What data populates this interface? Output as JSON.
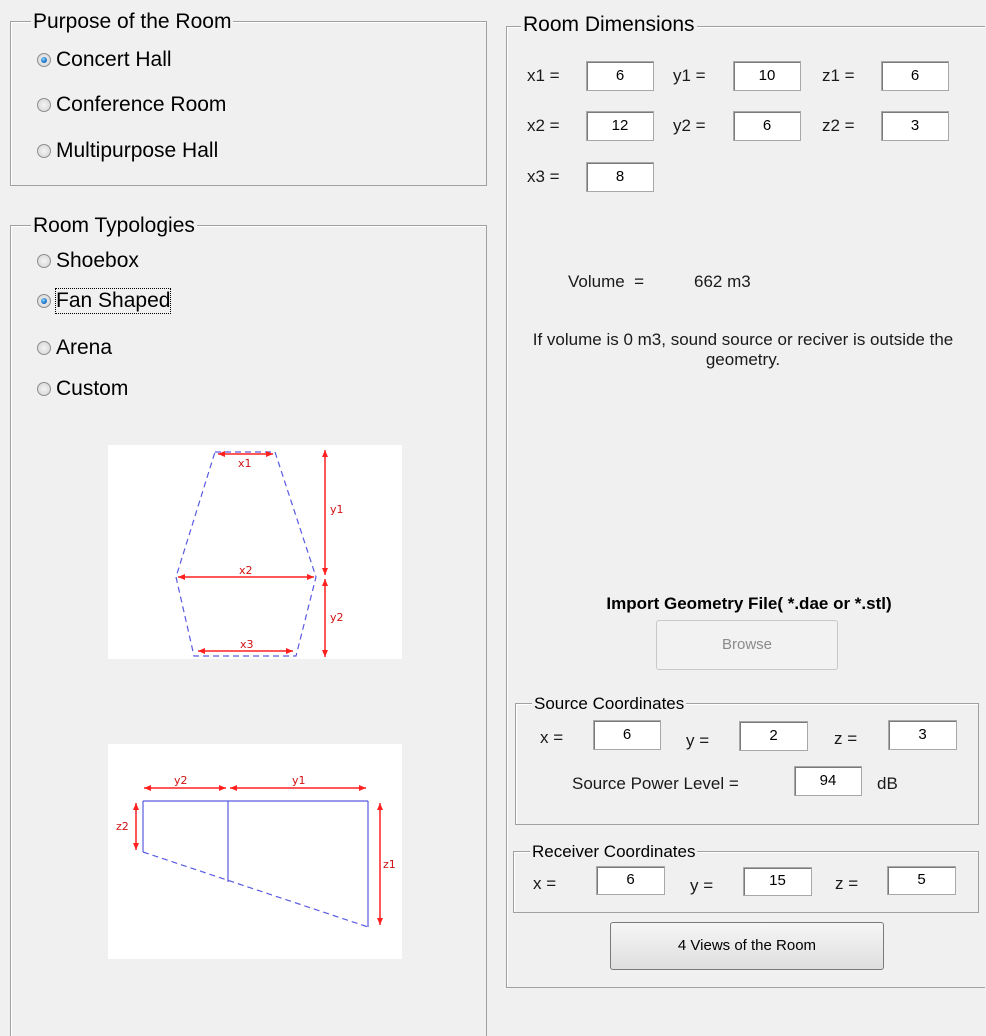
{
  "purpose_panel": {
    "title": "Purpose of the Room",
    "options": [
      {
        "label": "Concert Hall",
        "selected": true
      },
      {
        "label": "Conference Room",
        "selected": false
      },
      {
        "label": "Multipurpose Hall",
        "selected": false
      }
    ]
  },
  "typology_panel": {
    "title": "Room Typologies",
    "options": [
      {
        "label": "Shoebox",
        "selected": false
      },
      {
        "label": "Fan Shaped",
        "selected": true
      },
      {
        "label": "Arena",
        "selected": false
      },
      {
        "label": "Custom",
        "selected": false
      }
    ],
    "plan_labels": {
      "x1": "x1",
      "x2": "x2",
      "x3": "x3",
      "y1": "y1",
      "y2": "y2"
    },
    "section_labels": {
      "y2": "y2",
      "y1": "y1",
      "z2": "z2",
      "z1": "z1"
    }
  },
  "dimensions_panel": {
    "title": "Room Dimensions",
    "fields": {
      "x1": {
        "label": "x1 =",
        "value": "6"
      },
      "y1": {
        "label": "y1 =",
        "value": "10"
      },
      "z1": {
        "label": "z1 =",
        "value": "6"
      },
      "x2": {
        "label": "x2 =",
        "value": "12"
      },
      "y2": {
        "label": "y2 =",
        "value": "6"
      },
      "z2": {
        "label": "z2 =",
        "value": "3"
      },
      "x3": {
        "label": "x3 =",
        "value": "8"
      }
    },
    "volume_label": "Volume  =",
    "volume_value": "662 m3",
    "note": "If volume is 0 m3, sound source or reciver is outside the geometry.",
    "import_title": "Import Geometry File( *.dae or *.stl)",
    "browse_label": "Browse"
  },
  "source_panel": {
    "title": "Source Coordinates",
    "x_label": "x =",
    "x_value": "6",
    "y_label": "y =",
    "y_value": "2",
    "z_label": "z =",
    "z_value": "3",
    "power_label": "Source Power Level =",
    "power_value": "94",
    "power_unit": "dB"
  },
  "receiver_panel": {
    "title": "Receiver Coordinates",
    "x_label": "x =",
    "x_value": "6",
    "y_label": "y =",
    "y_value": "15",
    "z_label": "z =",
    "z_value": "5"
  },
  "views_button": "4 Views of the Room",
  "colors": {
    "dimension_red": "#ff2020",
    "outline_blue": "#5a5ae0",
    "radio_selected": "#1a74c7"
  }
}
